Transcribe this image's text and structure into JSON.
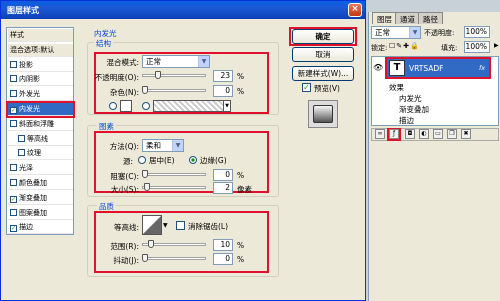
{
  "dialog": {
    "title": "图层样式",
    "close": "×"
  },
  "styles_list": [
    {
      "label": "样式",
      "type": "header"
    },
    {
      "label": "混合选项:默认",
      "type": "header"
    },
    {
      "label": "投影",
      "checked": false
    },
    {
      "label": "内阴影",
      "checked": false
    },
    {
      "label": "外发光",
      "checked": false
    },
    {
      "label": "内发光",
      "checked": true,
      "selected": true
    },
    {
      "label": "斜面和浮雕",
      "checked": false
    },
    {
      "label": "等高线",
      "checked": false,
      "indent": true
    },
    {
      "label": "纹理",
      "checked": false,
      "indent": true
    },
    {
      "label": "光泽",
      "checked": false
    },
    {
      "label": "颜色叠加",
      "checked": false
    },
    {
      "label": "渐变叠加",
      "checked": true
    },
    {
      "label": "图案叠加",
      "checked": false
    },
    {
      "label": "描边",
      "checked": true
    }
  ],
  "panel_title": "内发光",
  "structure": {
    "title": "结构",
    "blend_label": "混合模式:",
    "blend_value": "正常",
    "opacity_label": "不透明度(O):",
    "opacity_value": "23",
    "noise_label": "杂色(N):",
    "noise_value": "0",
    "percent": "%"
  },
  "elements": {
    "title": "图素",
    "method_label": "方法(Q):",
    "method_value": "柔和",
    "source_label": "源:",
    "center_label": "居中(E)",
    "edge_label": "边缘(G)",
    "choke_label": "阻塞(C):",
    "choke_value": "0",
    "size_label": "大小(S):",
    "size_value": "2",
    "px": "像素",
    "percent": "%"
  },
  "quality": {
    "title": "品质",
    "contour_label": "等高线:",
    "antialias_label": "消除锯齿(L)",
    "range_label": "范围(R):",
    "range_value": "10",
    "jitter_label": "抖动(J):",
    "jitter_value": "0",
    "percent": "%"
  },
  "buttons": {
    "ok": "确定",
    "cancel": "取消",
    "new_style": "新建样式(W)...",
    "preview": "预览(V)"
  },
  "layers": {
    "tabs": [
      "图层",
      "通道",
      "路径"
    ],
    "blend_mode": "正常",
    "opacity_label": "不透明度:",
    "opacity_value": "100%",
    "lock_label": "锁定:",
    "fill_label": "填充:",
    "fill_value": "100%",
    "layer_name": "VRTSADF",
    "layer_thumb": "T",
    "effects_label": "效果",
    "effects": [
      "内发光",
      "渐变叠加",
      "描边"
    ],
    "fx": "fx"
  },
  "colors": {
    "title_bar": "#1d58d6",
    "highlight": "#e0112b",
    "selection": "#316ac5"
  }
}
